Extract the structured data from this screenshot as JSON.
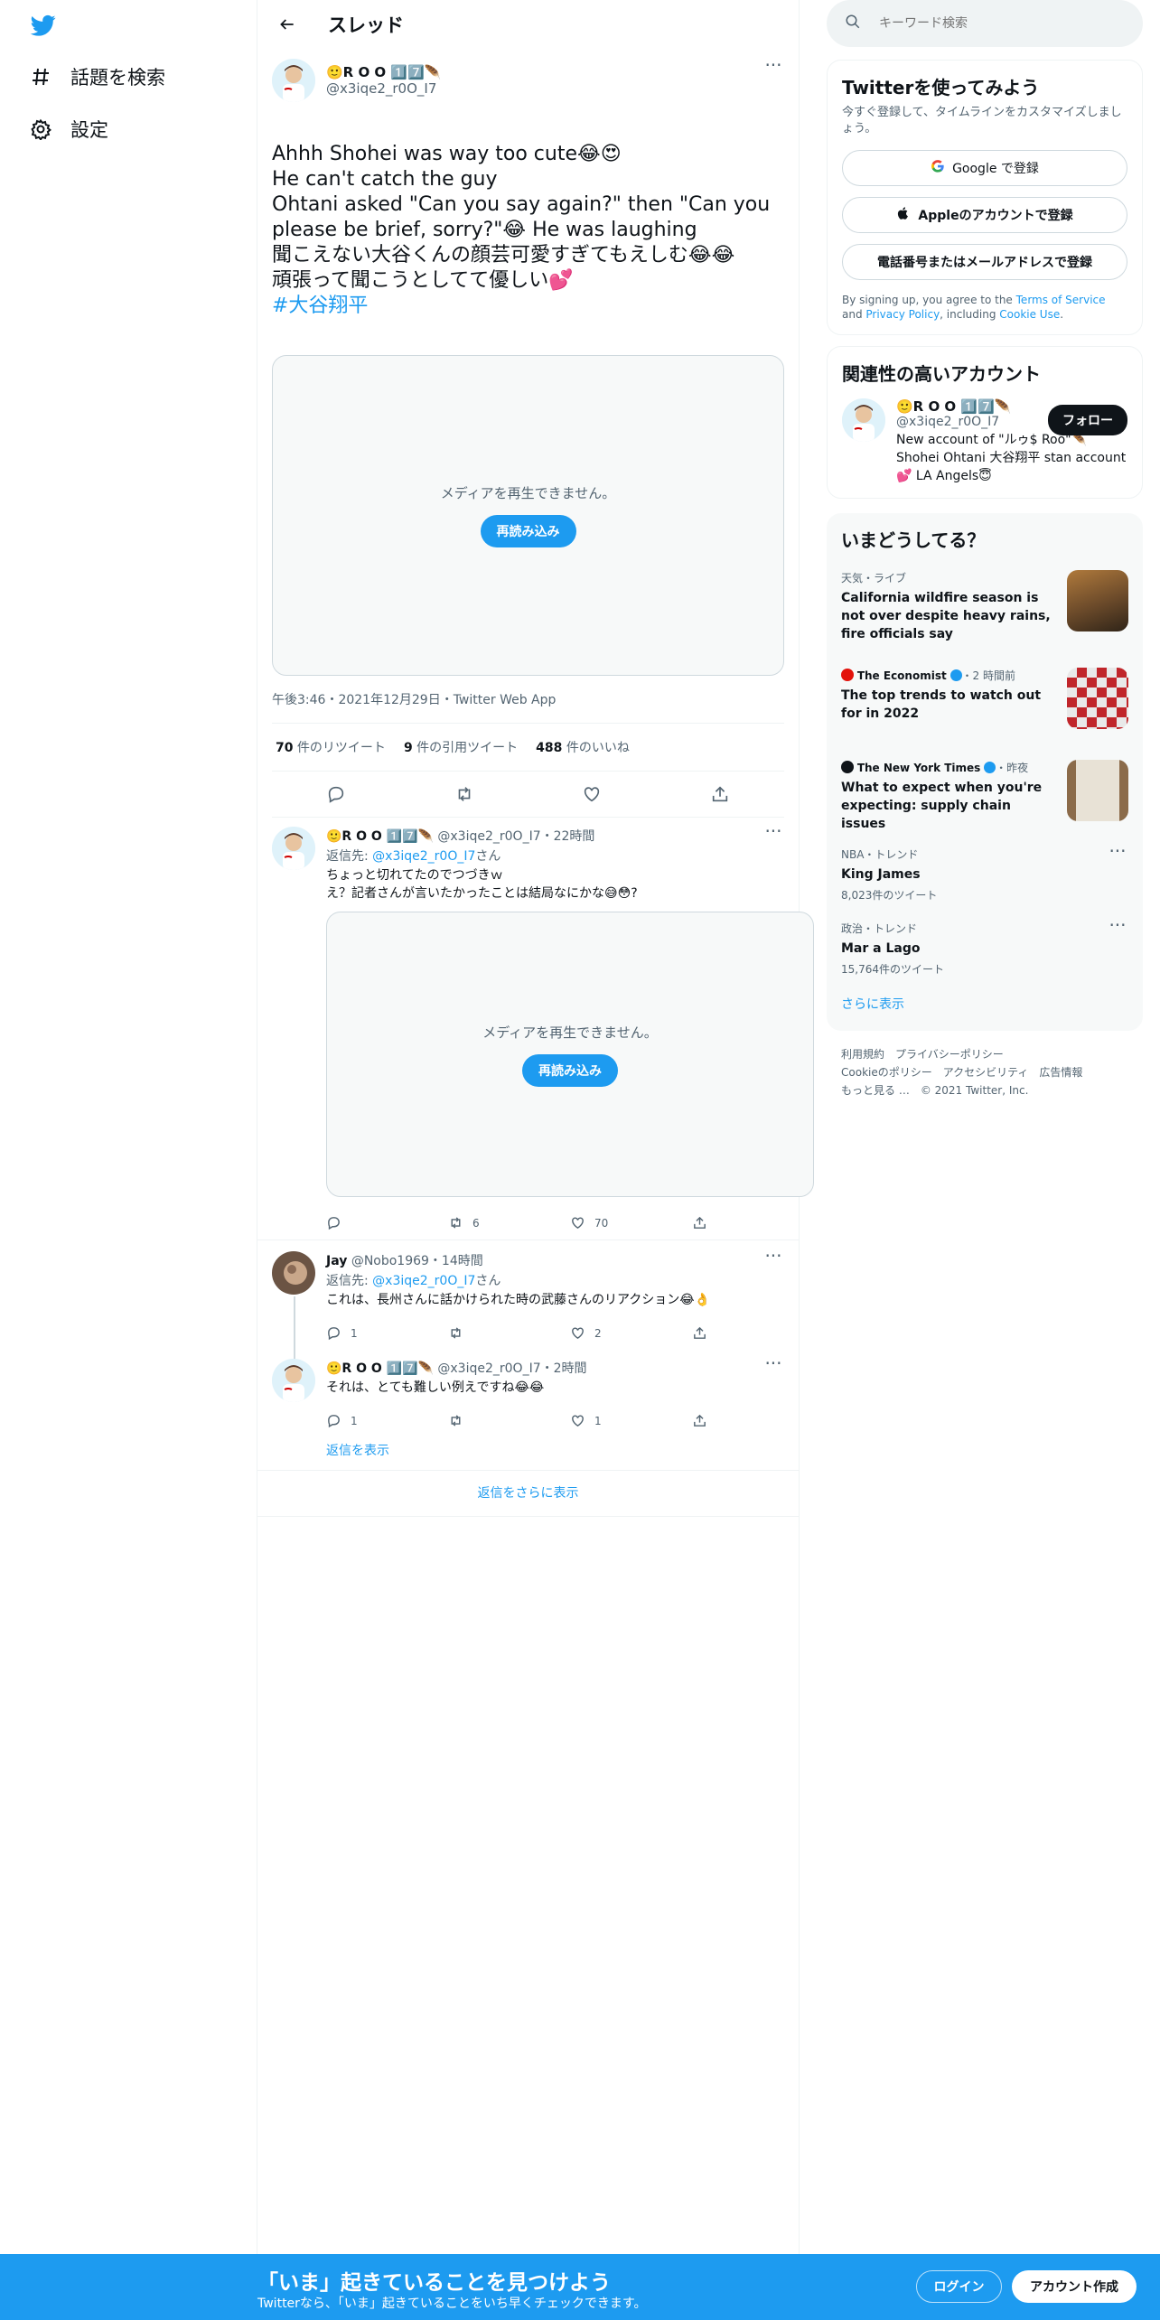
{
  "nav": {
    "logo": "twitter-bird-icon",
    "explore_label": "話題を検索",
    "settings_label": "設定"
  },
  "header": {
    "title": "スレッド"
  },
  "focal_tweet": {
    "display_name": "🙂R O O 1️⃣7️⃣🪶",
    "handle": "@x3iqe2_r0O_I7",
    "text": "Ahhh Shohei was way too cute😂😍\nHe can't catch the guy\nOhtani asked \"Can you say again?\" then \"Can you please be brief, sorry?\"😂 He was laughing\n聞こえない大谷くんの顔芸可愛すぎてもえしむ😂😂\n頑張って聞こうとしてて優しい💕",
    "hashtag": "#大谷翔平",
    "media_message": "メディアを再生できません。",
    "reload_label": "再読み込み",
    "timestamp": "午後3:46・2021年12月29日・Twitter Web App",
    "retweets": "70",
    "retweets_label": " 件のリツイート",
    "quotes": "9",
    "quotes_label": " 件の引用ツイート",
    "likes": "488",
    "likes_label": " 件のいいね"
  },
  "replies": [
    {
      "display_name": "🙂R O O 1️⃣7️⃣🪶",
      "handle_time": "@x3iqe2_r0O_I7・22時間",
      "reply_to_prefix": "返信先: ",
      "reply_to_handle": "@x3iqe2_r0O_I7",
      "reply_to_suffix": "さん",
      "text": "ちょっと切れてたのでつづきｗ\nえ？記者さんが言いたかったことは結局なにかな😅😳?",
      "media_message": "メディアを再生できません。",
      "reload_label": "再読み込み",
      "replies_count": "",
      "retweets_count": "6",
      "likes_count": "70"
    },
    {
      "display_name": "Jay",
      "handle_time": "@Nobo1969・14時間",
      "reply_to_prefix": "返信先: ",
      "reply_to_handle": "@x3iqe2_r0O_I7",
      "reply_to_suffix": "さん",
      "text": "これは、長州さんに話かけられた時の武藤さんのリアクション😂👌",
      "replies_count": "1",
      "retweets_count": "",
      "likes_count": "2"
    },
    {
      "display_name": "🙂R O O 1️⃣7️⃣🪶",
      "handle_time": "@x3iqe2_r0O_I7・2時間",
      "text": "それは、とても難しい例えですね😂😂",
      "replies_count": "1",
      "retweets_count": "",
      "likes_count": "1"
    }
  ],
  "show_replies_label": "返信を表示",
  "show_more_replies_label": "返信をさらに表示",
  "search": {
    "placeholder": "キーワード検索"
  },
  "signup_card": {
    "title": "Twitterを使ってみよう",
    "subtitle": "今すぐ登録して、タイムラインをカスタマイズしましょう。",
    "google_label": "Google で登録",
    "apple_label": "Appleのアカウントで登録",
    "phone_label": "電話番号またはメールアドレスで登録",
    "legal_prefix": "By signing up, you agree to the ",
    "terms": "Terms of Service",
    "and": " and ",
    "privacy": "Privacy Policy",
    "including": ", including ",
    "cookie": "Cookie Use",
    "period": "."
  },
  "relevant": {
    "title": "関連性の高いアカウント",
    "display_name": "🙂R O O 1️⃣7️⃣🪶",
    "handle": "@x3iqe2_r0O_I7",
    "bio": "New account of \"ルゥ$ Roo\"🪶 Shohei Ohtani 大谷翔平 stan account 💕   LA Angels😇",
    "follow_label": "フォロー"
  },
  "trends": {
    "title": "いまどうしてる？",
    "items": [
      {
        "meta": "天気・ライブ",
        "title": "California wildfire season is not over despite heavy rains, fire officials say",
        "thumb": "wildfire-photo"
      },
      {
        "source": "The Economist",
        "meta": "・2 時間前",
        "title": "The top trends to watch out for in 2022",
        "thumb": "balls-photo"
      },
      {
        "source": "The New York Times",
        "meta": "・昨夜",
        "title": "What to expect when you're expecting: supply chain issues",
        "thumb": "shelves-photo"
      },
      {
        "meta": "NBA・トレンド",
        "title": "King James",
        "count": "8,023件のツイート"
      },
      {
        "meta": "政治・トレンド",
        "title": "Mar a Lago",
        "count": "15,764件のツイート"
      }
    ],
    "show_more": "さらに表示"
  },
  "footer": {
    "terms": "利用規約",
    "privacy": "プライバシーポリシー",
    "cookie": "Cookieのポリシー",
    "accessibility": "アクセシビリティ",
    "ads": "広告情報",
    "more": "もっと見る …",
    "copyright": "© 2021 Twitter, Inc."
  },
  "banner": {
    "title": "「いま」起きていることを見つけよう",
    "subtitle": "Twitterなら、「いま」起きていることをいち早くチェックできます。",
    "login_label": "ログイン",
    "signup_label": "アカウント作成"
  },
  "colors": {
    "accent": "#1d9bf0",
    "text": "#0f1419",
    "secondary": "#536471"
  }
}
